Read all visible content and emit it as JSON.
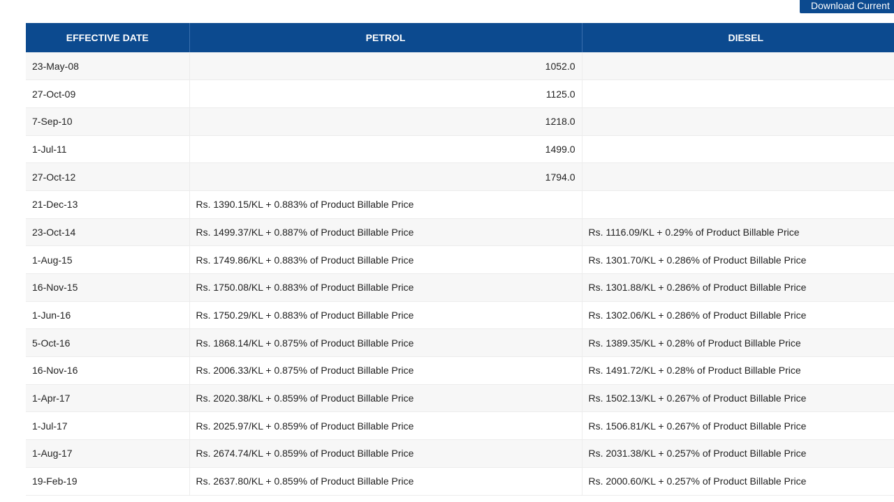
{
  "toolbar": {
    "download_label": "Download Current"
  },
  "table": {
    "headers": [
      "EFFECTIVE DATE",
      "PETROL",
      "DIESEL"
    ],
    "rows": [
      {
        "date": "23-May-08",
        "petrol": "1052.0",
        "diesel": ""
      },
      {
        "date": "27-Oct-09",
        "petrol": "1125.0",
        "diesel": ""
      },
      {
        "date": "7-Sep-10",
        "petrol": "1218.0",
        "diesel": ""
      },
      {
        "date": "1-Jul-11",
        "petrol": "1499.0",
        "diesel": ""
      },
      {
        "date": "27-Oct-12",
        "petrol": "1794.0",
        "diesel": ""
      },
      {
        "date": "21-Dec-13",
        "petrol": "Rs. 1390.15/KL + 0.883% of Product Billable Price",
        "diesel": ""
      },
      {
        "date": "23-Oct-14",
        "petrol": "Rs. 1499.37/KL + 0.887% of Product Billable Price",
        "diesel": "Rs. 1116.09/KL + 0.29% of Product Billable Price"
      },
      {
        "date": "1-Aug-15",
        "petrol": "Rs. 1749.86/KL + 0.883% of Product Billable Price",
        "diesel": "Rs. 1301.70/KL + 0.286% of Product Billable Price"
      },
      {
        "date": "16-Nov-15",
        "petrol": "Rs. 1750.08/KL + 0.883% of Product Billable Price",
        "diesel": "Rs. 1301.88/KL + 0.286% of Product Billable Price"
      },
      {
        "date": "1-Jun-16",
        "petrol": "Rs. 1750.29/KL + 0.883% of Product Billable Price",
        "diesel": "Rs. 1302.06/KL + 0.286% of Product Billable Price"
      },
      {
        "date": "5-Oct-16",
        "petrol": "Rs. 1868.14/KL + 0.875% of Product Billable Price",
        "diesel": "Rs. 1389.35/KL + 0.28% of Product Billable Price"
      },
      {
        "date": "16-Nov-16",
        "petrol": "Rs. 2006.33/KL + 0.875% of Product Billable Price",
        "diesel": "Rs. 1491.72/KL + 0.28% of Product Billable Price"
      },
      {
        "date": "1-Apr-17",
        "petrol": "Rs. 2020.38/KL + 0.859% of Product Billable Price",
        "diesel": "Rs. 1502.13/KL + 0.267% of Product Billable Price"
      },
      {
        "date": "1-Jul-17",
        "petrol": "Rs. 2025.97/KL + 0.859% of Product Billable Price",
        "diesel": "Rs. 1506.81/KL + 0.267% of Product Billable Price"
      },
      {
        "date": "1-Aug-17",
        "petrol": "Rs. 2674.74/KL + 0.859% of Product Billable Price",
        "diesel": "Rs. 2031.38/KL + 0.257% of Product Billable Price"
      },
      {
        "date": "19-Feb-19",
        "petrol": "Rs. 2637.80/KL + 0.859% of Product Billable Price",
        "diesel": "Rs. 2000.60/KL + 0.257% of Product Billable Price"
      }
    ]
  },
  "colors": {
    "header_bg": "#0c4a8f",
    "header_text": "#ffffff",
    "row_alt_bg": "#f7f7f7"
  }
}
